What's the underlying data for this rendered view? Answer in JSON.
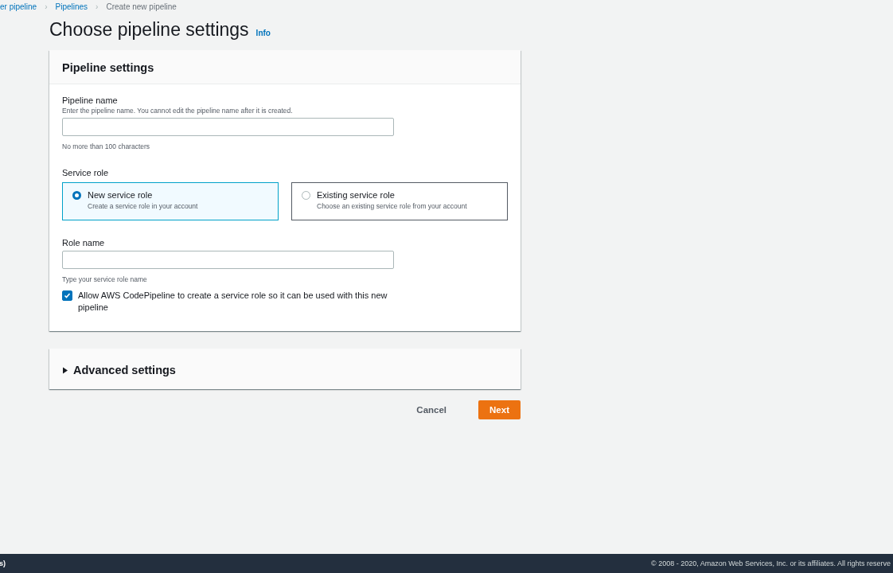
{
  "breadcrumbs": [
    {
      "label": "er pipeline",
      "separator": "›"
    },
    {
      "label": "Pipelines",
      "separator": "›"
    },
    {
      "label": "Create new pipeline"
    }
  ],
  "page": {
    "title": "Choose pipeline settings",
    "info_link": "Info"
  },
  "pipeline_settings": {
    "heading": "Pipeline settings",
    "pipeline_name": {
      "label": "Pipeline name",
      "description": "Enter the pipeline name. You cannot edit the pipeline name after it is created.",
      "constraint": "No more than 100 characters"
    },
    "service_role": {
      "label": "Service role",
      "options": [
        {
          "title": "New service role",
          "description": "Create a service role in your account",
          "selected": true
        },
        {
          "title": "Existing service role",
          "description": "Choose an existing service role from your account",
          "selected": false
        }
      ]
    },
    "role_name": {
      "label": "Role name",
      "hint": "Type your service role name"
    },
    "allow_checkbox": {
      "label": "Allow AWS CodePipeline to create a service role so it can be used with this new pipeline",
      "checked": true
    }
  },
  "advanced_settings": {
    "label": "Advanced settings",
    "expanded": false
  },
  "buttons": [
    {
      "label": "Cancel",
      "kind": "link"
    },
    {
      "label": "Next",
      "kind": "primary"
    }
  ],
  "footer": {
    "left": "s)",
    "copyright": "© 2008 - 2020, Amazon Web Services, Inc. or its affiliates. All rights reserve"
  }
}
